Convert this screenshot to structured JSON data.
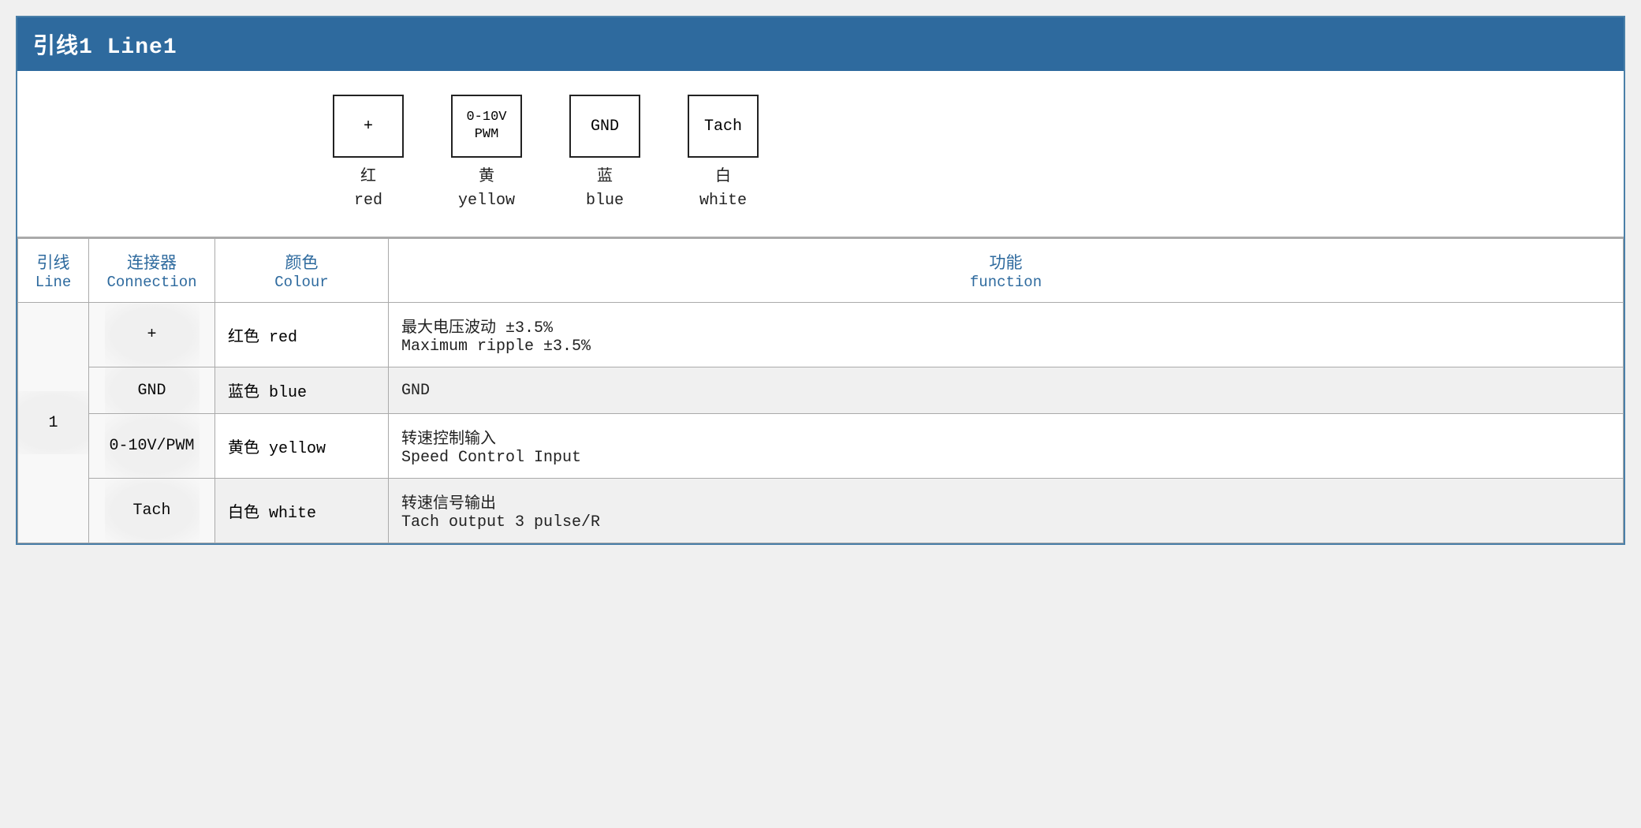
{
  "header": {
    "title": "引线1 Line1"
  },
  "diagram": {
    "connectors": [
      {
        "id": "plus",
        "symbol": "+",
        "zh": "红",
        "en": "red"
      },
      {
        "id": "pwm",
        "symbol": "0-10V\nPWM",
        "zh": "黄",
        "en": "yellow"
      },
      {
        "id": "gnd",
        "symbol": "GND",
        "zh": "蓝",
        "en": "blue"
      },
      {
        "id": "tach",
        "symbol": "Tach",
        "zh": "白",
        "en": "white"
      }
    ]
  },
  "table": {
    "headers": {
      "line_zh": "引线",
      "line_en": "Line",
      "conn_zh": "连接器",
      "conn_en": "Connection",
      "colour_zh": "颜色",
      "colour_en": "Colour",
      "func_zh": "功能",
      "func_en": "function"
    },
    "rows": [
      {
        "line": "1",
        "connection": "+",
        "colour_zh": "红色",
        "colour_en": "red",
        "func_zh": "最大电压波动 ±3.5%",
        "func_en": "Maximum ripple ±3.5%",
        "shade": "white"
      },
      {
        "line": "",
        "connection": "GND",
        "colour_zh": "蓝色",
        "colour_en": "blue",
        "func_zh": "GND",
        "func_en": "",
        "shade": "shaded"
      },
      {
        "line": "",
        "connection": "0-10V/PWM",
        "colour_zh": "黄色",
        "colour_en": "yellow",
        "func_zh": "转速控制输入",
        "func_en": "Speed Control Input",
        "shade": "white"
      },
      {
        "line": "",
        "connection": "Tach",
        "colour_zh": "白色",
        "colour_en": "white",
        "func_zh": "转速信号输出",
        "func_en": "Tach output 3 pulse/R",
        "shade": "shaded"
      }
    ]
  }
}
